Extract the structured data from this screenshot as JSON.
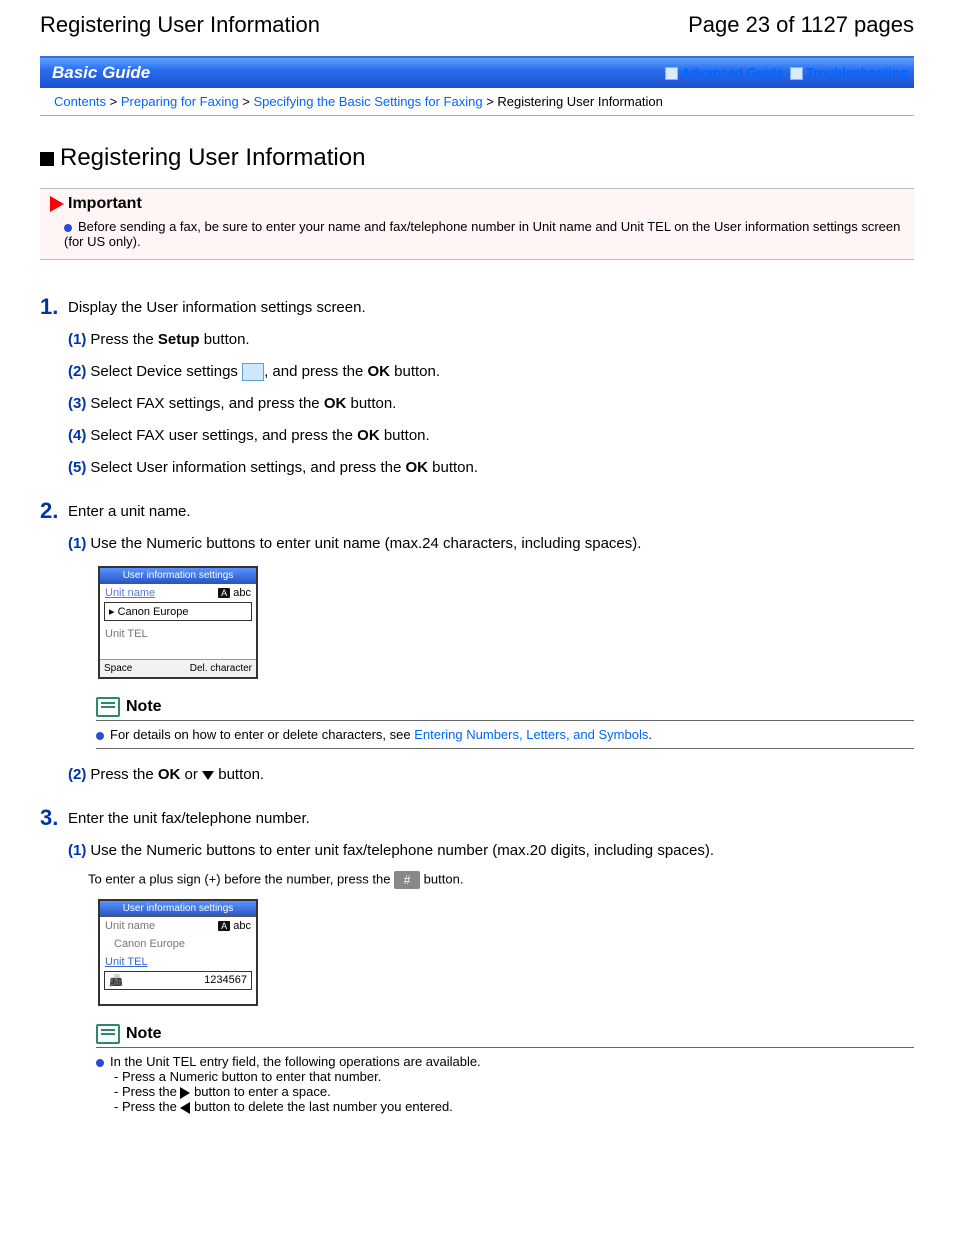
{
  "header": {
    "title": "Registering User Information",
    "page": "Page 23 of 1127 pages"
  },
  "banner": {
    "label": "Basic Guide",
    "links": {
      "advanced": "Advanced Guide",
      "trouble": "Troubleshooting"
    }
  },
  "crumbs": {
    "c1": "Contents",
    "c2": "Preparing for Faxing",
    "c3": "Specifying the Basic Settings for Faxing",
    "c4": "Registering User Information",
    "sep": ">"
  },
  "h1": "Registering User Information",
  "important": {
    "label": "Important",
    "text": "Before sending a fax, be sure to enter your name and fax/telephone number in Unit name and Unit TEL on the User information settings screen (for US only)."
  },
  "step1": {
    "num": "1.",
    "title": "Display the User information settings screen.",
    "s1": {
      "n": "(1)",
      "a": "Press the ",
      "b": "Setup",
      "c": " button."
    },
    "s2": {
      "n": "(2)",
      "a": "Select Device settings ",
      "b": ", and press the ",
      "ok": "OK",
      "c": " button."
    },
    "s3": {
      "n": "(3)",
      "a": "Select FAX settings, and press the ",
      "ok": "OK",
      "b": " button."
    },
    "s4": {
      "n": "(4)",
      "a": "Select FAX user settings, and press the ",
      "ok": "OK",
      "b": " button."
    },
    "s5": {
      "n": "(5)",
      "a": "Select User information settings, and press the ",
      "ok": "OK",
      "b": " button."
    }
  },
  "step2": {
    "num": "2.",
    "title": "Enter a unit name.",
    "s1": {
      "n": "(1)",
      "text": "Use the Numeric buttons to enter unit name (max.24 characters, including spaces)."
    },
    "s2": {
      "n": "(2)",
      "a": "Press the ",
      "ok": "OK",
      "b": " or ",
      "c": " button."
    }
  },
  "lcd1": {
    "title": "User information settings",
    "unit_name_label": "Unit name",
    "mode": "abc",
    "unit_name_val": "Canon Europe",
    "unit_tel_label": "Unit TEL",
    "btn_left": "Space",
    "btn_right": "Del. character"
  },
  "note1": {
    "label": "Note",
    "a": "For details on how to enter or delete characters, see ",
    "link": "Entering Numbers, Letters, and Symbols",
    "b": "."
  },
  "step3": {
    "num": "3.",
    "title": "Enter the unit fax/telephone number.",
    "s1": {
      "n": "(1)",
      "text": "Use the Numeric buttons to enter unit fax/telephone number (max.20 digits, including spaces)."
    },
    "hint": {
      "a": "To enter a plus sign (+) before the number, press the ",
      "hash": "#",
      "b": " button."
    }
  },
  "lcd2": {
    "title": "User information settings",
    "unit_name_label": "Unit name",
    "mode": "abc",
    "unit_name_val": "Canon Europe",
    "unit_tel_label": "Unit TEL",
    "unit_tel_val": "1234567"
  },
  "note2": {
    "label": "Note",
    "lead": "In the Unit TEL entry field, the following operations are available.",
    "l1": "- Press a Numeric button to enter that number.",
    "l2a": "- Press the ",
    "l2b": " button to enter a space.",
    "l3a": "- Press the ",
    "l3b": " button to delete the last number you entered."
  }
}
